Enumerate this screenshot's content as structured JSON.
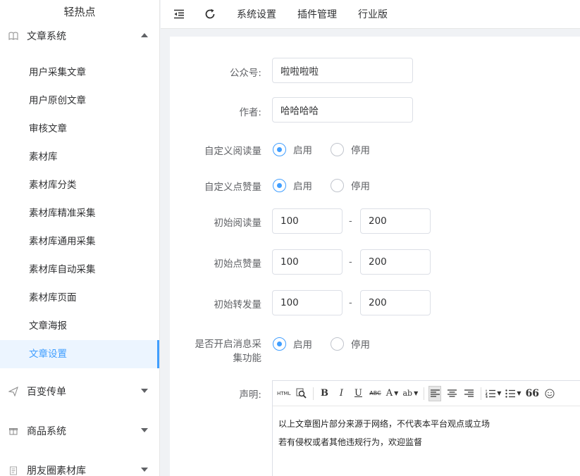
{
  "app": {
    "logo": "轻热点"
  },
  "sidebar": {
    "groups": [
      {
        "label": "文章系统",
        "icon": "book-icon",
        "expanded": true
      },
      {
        "label": "百变传单",
        "icon": "send-icon",
        "expanded": false
      },
      {
        "label": "商品系统",
        "icon": "gift-icon",
        "expanded": false
      },
      {
        "label": "朋友圈素材库",
        "icon": "document-icon",
        "expanded": false
      }
    ],
    "article_items": [
      "用户采集文章",
      "用户原创文章",
      "审核文章",
      "素材库",
      "素材库分类",
      "素材库精准采集",
      "素材库通用采集",
      "素材库自动采集",
      "素材库页面",
      "文章海报",
      "文章设置"
    ],
    "active_item": "文章设置"
  },
  "header": {
    "nav": [
      "系统设置",
      "插件管理",
      "行业版"
    ],
    "icons": [
      "menu-fold-icon",
      "refresh-icon"
    ]
  },
  "form": {
    "account_label": "公众号:",
    "account_value": "啦啦啦啦",
    "author_label": "作者:",
    "author_value": "哈哈哈哈",
    "custom_read_label": "自定义阅读量",
    "custom_like_label": "自定义点赞量",
    "init_read_label": "初始阅读量",
    "init_like_label": "初始点赞量",
    "init_share_label": "初始转发量",
    "msg_collect_label_1": "是否开启消息采",
    "msg_collect_label_2": "集功能",
    "enable_label": "启用",
    "disable_label": "停用",
    "range_sep": "-",
    "init_read_min": "100",
    "init_read_max": "200",
    "init_like_min": "100",
    "init_like_max": "200",
    "init_share_min": "100",
    "init_share_max": "200",
    "custom_read_enabled": true,
    "custom_like_enabled": true,
    "msg_collect_enabled": true,
    "statement_label": "声明:",
    "statement_lines": [
      "以上文章图片部分来源于网络，不代表本平台观点或立场",
      "若有侵权或者其他违规行为，欢迎监督"
    ]
  },
  "editor": {
    "toolbar": {
      "html": "HTML",
      "bold": "B",
      "italic": "I",
      "underline": "U",
      "strike": "ABC",
      "font": "A",
      "highlight": "ab",
      "quote": "66"
    }
  },
  "colors": {
    "accent": "#409eff",
    "active_bg": "#ecf5ff"
  }
}
